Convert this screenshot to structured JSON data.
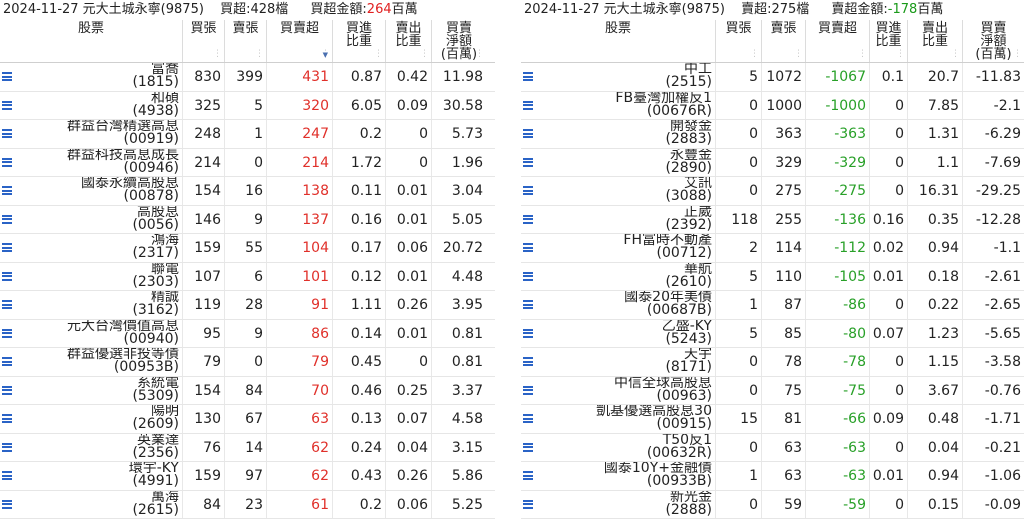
{
  "left": {
    "date_broker": "2024-11-27 元大土城永寧(9875)",
    "count": "買超:428檔",
    "amount_label": "買超金額:",
    "amount_value": "264",
    "amount_unit": "百萬",
    "headers": [
      "股票",
      "買張",
      "賣張",
      "買賣超",
      "買進\n比重",
      "賣出\n比重",
      "買賣\n淨額\n(百萬)"
    ],
    "rows": [
      {
        "name": "富喬",
        "code": "(1815)",
        "buy": "830",
        "sell": "399",
        "net": "431",
        "bp": "0.87",
        "sp": "0.42",
        "amt": "11.98"
      },
      {
        "name": "和碩",
        "code": "(4938)",
        "buy": "325",
        "sell": "5",
        "net": "320",
        "bp": "6.05",
        "sp": "0.09",
        "amt": "30.58"
      },
      {
        "name": "群益台灣精選高息",
        "code": "(00919)",
        "buy": "248",
        "sell": "1",
        "net": "247",
        "bp": "0.2",
        "sp": "0",
        "amt": "5.73"
      },
      {
        "name": "群益科技高息成長",
        "code": "(00946)",
        "buy": "214",
        "sell": "0",
        "net": "214",
        "bp": "1.72",
        "sp": "0",
        "amt": "1.96"
      },
      {
        "name": "國泰永續高股息",
        "code": "(00878)",
        "buy": "154",
        "sell": "16",
        "net": "138",
        "bp": "0.11",
        "sp": "0.01",
        "amt": "3.04"
      },
      {
        "name": "高股息",
        "code": "(0056)",
        "buy": "146",
        "sell": "9",
        "net": "137",
        "bp": "0.16",
        "sp": "0.01",
        "amt": "5.05"
      },
      {
        "name": "鴻海",
        "code": "(2317)",
        "buy": "159",
        "sell": "55",
        "net": "104",
        "bp": "0.17",
        "sp": "0.06",
        "amt": "20.72"
      },
      {
        "name": "聯電",
        "code": "(2303)",
        "buy": "107",
        "sell": "6",
        "net": "101",
        "bp": "0.12",
        "sp": "0.01",
        "amt": "4.48"
      },
      {
        "name": "精誠",
        "code": "(3162)",
        "buy": "119",
        "sell": "28",
        "net": "91",
        "bp": "1.11",
        "sp": "0.26",
        "amt": "3.95"
      },
      {
        "name": "元大台灣價值高息",
        "code": "(00940)",
        "buy": "95",
        "sell": "9",
        "net": "86",
        "bp": "0.14",
        "sp": "0.01",
        "amt": "0.81"
      },
      {
        "name": "群益優選非投等債",
        "code": "(00953B)",
        "buy": "79",
        "sell": "0",
        "net": "79",
        "bp": "0.45",
        "sp": "0",
        "amt": "0.81"
      },
      {
        "name": "系統電",
        "code": "(5309)",
        "buy": "154",
        "sell": "84",
        "net": "70",
        "bp": "0.46",
        "sp": "0.25",
        "amt": "3.37"
      },
      {
        "name": "陽明",
        "code": "(2609)",
        "buy": "130",
        "sell": "67",
        "net": "63",
        "bp": "0.13",
        "sp": "0.07",
        "amt": "4.58"
      },
      {
        "name": "英業達",
        "code": "(2356)",
        "buy": "76",
        "sell": "14",
        "net": "62",
        "bp": "0.24",
        "sp": "0.04",
        "amt": "3.15"
      },
      {
        "name": "環宇-KY",
        "code": "(4991)",
        "buy": "159",
        "sell": "97",
        "net": "62",
        "bp": "0.43",
        "sp": "0.26",
        "amt": "5.86"
      },
      {
        "name": "萬海",
        "code": "(2615)",
        "buy": "84",
        "sell": "23",
        "net": "61",
        "bp": "0.2",
        "sp": "0.06",
        "amt": "5.25"
      }
    ]
  },
  "right": {
    "date_broker": "2024-11-27 元大土城永寧(9875)",
    "count": "賣超:275檔",
    "amount_label": "賣超金額:",
    "amount_value": "-178",
    "amount_unit": "百萬",
    "headers": [
      "股票",
      "買張",
      "賣張",
      "買賣超",
      "買進\n比重",
      "賣出\n比重",
      "買賣\n淨額\n(百萬)"
    ],
    "rows": [
      {
        "name": "中工",
        "code": "(2515)",
        "buy": "5",
        "sell": "1072",
        "net": "-1067",
        "bp": "0.1",
        "sp": "20.7",
        "amt": "-11.83"
      },
      {
        "name": "FB臺灣加權反1",
        "code": "(00676R)",
        "buy": "0",
        "sell": "1000",
        "net": "-1000",
        "bp": "0",
        "sp": "7.85",
        "amt": "-2.1"
      },
      {
        "name": "開發金",
        "code": "(2883)",
        "buy": "0",
        "sell": "363",
        "net": "-363",
        "bp": "0",
        "sp": "1.31",
        "amt": "-6.29"
      },
      {
        "name": "永豐金",
        "code": "(2890)",
        "buy": "0",
        "sell": "329",
        "net": "-329",
        "bp": "0",
        "sp": "1.1",
        "amt": "-7.69"
      },
      {
        "name": "艾訊",
        "code": "(3088)",
        "buy": "0",
        "sell": "275",
        "net": "-275",
        "bp": "0",
        "sp": "16.31",
        "amt": "-29.25"
      },
      {
        "name": "正崴",
        "code": "(2392)",
        "buy": "118",
        "sell": "255",
        "net": "-136",
        "bp": "0.16",
        "sp": "0.35",
        "amt": "-12.28"
      },
      {
        "name": "FH富時不動產",
        "code": "(00712)",
        "buy": "2",
        "sell": "114",
        "net": "-112",
        "bp": "0.02",
        "sp": "0.94",
        "amt": "-1.1"
      },
      {
        "name": "華航",
        "code": "(2610)",
        "buy": "5",
        "sell": "110",
        "net": "-105",
        "bp": "0.01",
        "sp": "0.18",
        "amt": "-2.61"
      },
      {
        "name": "國泰20年美債",
        "code": "(00687B)",
        "buy": "1",
        "sell": "87",
        "net": "-86",
        "bp": "0",
        "sp": "0.22",
        "amt": "-2.65"
      },
      {
        "name": "乙盛-KY",
        "code": "(5243)",
        "buy": "5",
        "sell": "85",
        "net": "-80",
        "bp": "0.07",
        "sp": "1.23",
        "amt": "-5.65"
      },
      {
        "name": "天宇",
        "code": "(8171)",
        "buy": "0",
        "sell": "78",
        "net": "-78",
        "bp": "0",
        "sp": "1.15",
        "amt": "-3.58"
      },
      {
        "name": "中信全球高股息",
        "code": "(00963)",
        "buy": "0",
        "sell": "75",
        "net": "-75",
        "bp": "0",
        "sp": "3.67",
        "amt": "-0.76"
      },
      {
        "name": "凱基優選高股息30",
        "code": "(00915)",
        "buy": "15",
        "sell": "81",
        "net": "-66",
        "bp": "0.09",
        "sp": "0.48",
        "amt": "-1.71"
      },
      {
        "name": "T50反1",
        "code": "(00632R)",
        "buy": "0",
        "sell": "63",
        "net": "-63",
        "bp": "0",
        "sp": "0.04",
        "amt": "-0.21"
      },
      {
        "name": "國泰10Y+金融債",
        "code": "(00933B)",
        "buy": "1",
        "sell": "63",
        "net": "-63",
        "bp": "0.01",
        "sp": "0.94",
        "amt": "-1.06"
      },
      {
        "name": "新光金",
        "code": "(2888)",
        "buy": "0",
        "sell": "59",
        "net": "-59",
        "bp": "0",
        "sp": "0.15",
        "amt": "-0.09"
      }
    ]
  },
  "colors": {
    "positive": "#e0302a",
    "negative": "#28a028",
    "menu_icon": "#2a63c6"
  },
  "icons": {
    "row_menu": "list-menu-icon",
    "sort": "sort-desc-icon"
  }
}
